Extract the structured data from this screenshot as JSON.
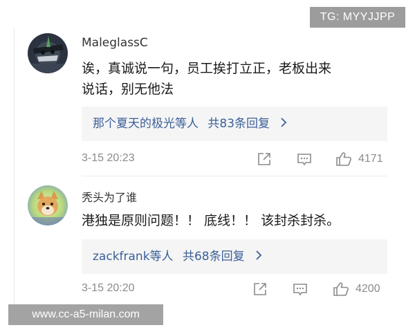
{
  "watermarks": {
    "top_right": "TG: MYYJJPP",
    "bottom_left": "www.cc-a5-milan.com"
  },
  "comments": [
    {
      "username": "MaleglassC",
      "avatar_icon": "avatar-icon",
      "text_line1": "诶，真诚说一句，员工挨打立正，老板出来",
      "text_line2": "说话，别无他法",
      "reply_names": "那个夏天的极光",
      "reply_suffix": "等人",
      "reply_count": "共83条回复",
      "timestamp": "3-15 20:23",
      "like_count": "4171"
    },
    {
      "username": "秃头为了谁",
      "avatar_icon": "avatar-icon",
      "text_line1": "港独是原则问题！！ 底线！！ 该封杀封杀。",
      "reply_names": "zackfrank",
      "reply_suffix": "等人",
      "reply_count": "共68条回复",
      "timestamp": "3-15 20:20",
      "like_count": "4200"
    }
  ],
  "icons": {
    "share": "share-icon",
    "comment": "comment-icon",
    "like": "thumbs-up-icon",
    "chevron": "chevron-right-icon"
  },
  "colors": {
    "link_blue": "#3a5f98",
    "meta_gray": "#8a8a8a",
    "reply_bg": "#f5f5f5",
    "watermark_bg": "#9c9c9c"
  }
}
